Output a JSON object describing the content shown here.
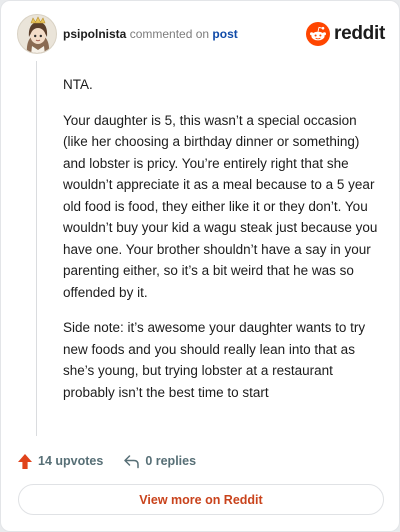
{
  "header": {
    "username": "psipolnista",
    "commented_text": "commented on",
    "post_link": "post",
    "brand": "reddit"
  },
  "comment": {
    "paragraphs": [
      "NTA.",
      "Your daughter is 5, this wasn’t a special occasion (like her choosing a birthday dinner or something) and lobster is pricy. You’re entirely right that she wouldn’t appreciate it as a meal because to a 5 year old food is food, they either like it or they don’t. You wouldn’t buy your kid a wagu steak just because you have one. Your brother shouldn’t have a say in your parenting either, so it’s a bit weird that he was so offended by it.",
      "Side note: it’s awesome your daughter wants to try new foods and you should really lean into that as she’s young, but trying lobster at a restaurant probably isn’t the best time to start"
    ]
  },
  "actions": {
    "upvotes": "14 upvotes",
    "replies": "0 replies"
  },
  "footer": {
    "view_more": "View more on Reddit"
  },
  "colors": {
    "brand_orange": "#ff4500",
    "upvote_orange": "#e0431b",
    "link_blue": "#0f4aa8",
    "view_more_text": "#c9431c"
  },
  "icons": [
    "avatar",
    "reddit-logo-icon",
    "upvote-arrow-icon",
    "reply-icon"
  ]
}
